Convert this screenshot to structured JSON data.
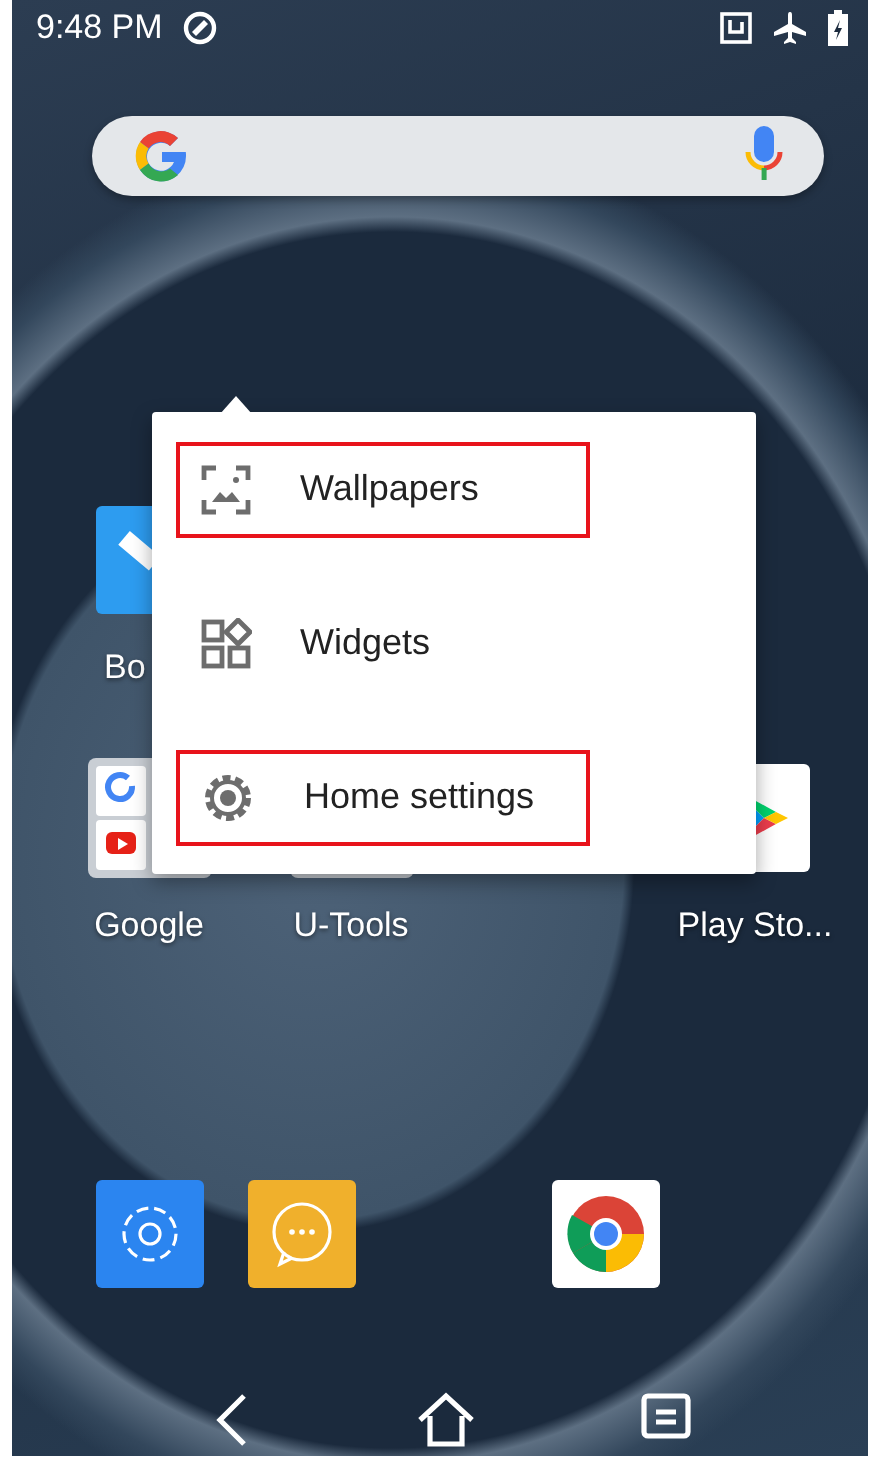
{
  "status_bar": {
    "time": "9:48 PM"
  },
  "home_rows": [
    [
      {
        "kind": "measure",
        "label": "Bo",
        "covered": true
      }
    ],
    [
      {
        "kind": "googlefolder",
        "label": "Google",
        "covered": false
      },
      {
        "kind": "toolsfolder",
        "label": "U-Tools",
        "covered": false
      },
      {
        "kind": "blank"
      },
      {
        "kind": "store",
        "label": "Play Sto...",
        "covered": false
      }
    ]
  ],
  "dock": [
    {
      "kind": "settings"
    },
    {
      "kind": "messages"
    },
    {
      "kind": "blank"
    },
    {
      "kind": "browser"
    }
  ],
  "popup_menu": {
    "items": [
      {
        "kind": "wallpaper",
        "label": "Wallpapers",
        "highlighted": true
      },
      {
        "kind": "widgets",
        "label": "Widgets",
        "highlighted": false
      },
      {
        "kind": "gear",
        "label": "Home settings",
        "highlighted": true
      }
    ]
  }
}
